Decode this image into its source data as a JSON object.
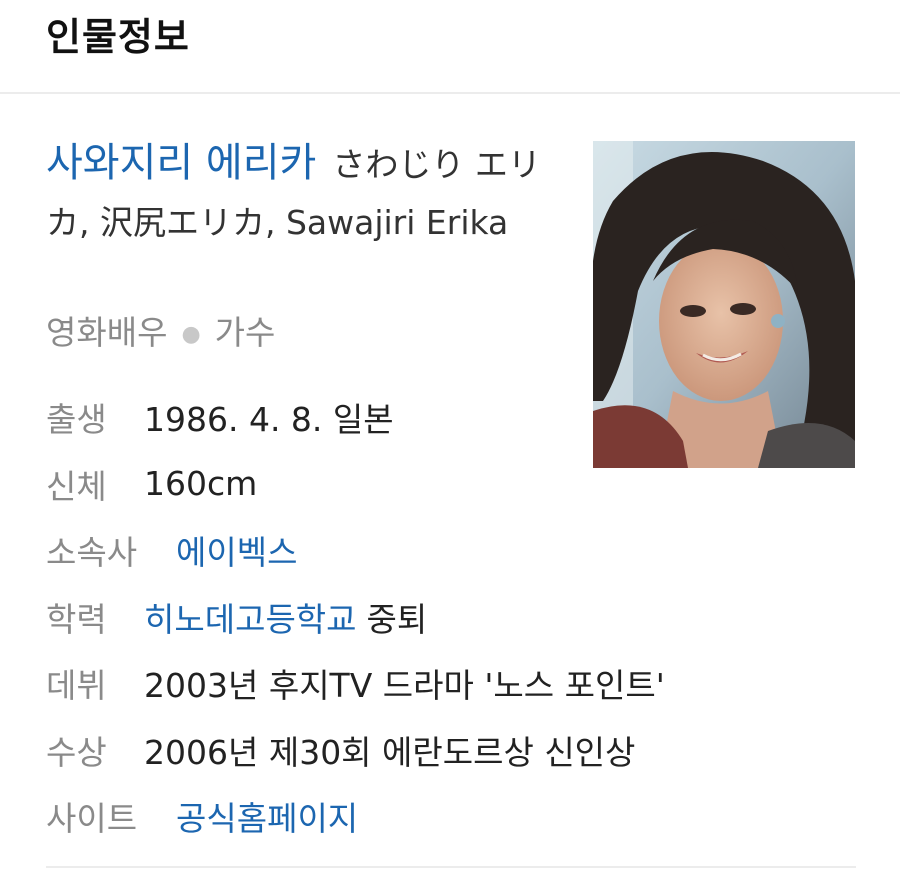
{
  "header": {
    "title": "인물정보"
  },
  "profile": {
    "name_ko": "사와지리 에리카",
    "name_jp": "さわじり エリカ, 沢尻エリカ, Sawajiri Erika",
    "occupations": [
      "영화배우",
      "가수"
    ],
    "photo_icon": "portrait-photo"
  },
  "info": {
    "birth": {
      "label": "출생",
      "value": "1986. 4. 8. 일본"
    },
    "body": {
      "label": "신체",
      "value": "160cm"
    },
    "agency": {
      "label": "소속사",
      "link": "에이벡스"
    },
    "education": {
      "label": "학력",
      "link": "히노데고등학교",
      "suffix": "중퇴"
    },
    "debut": {
      "label": "데뷔",
      "value": "2003년 후지TV 드라마 '노스 포인트'"
    },
    "award": {
      "label": "수상",
      "value": "2006년 제30회 에란도르상 신인상"
    },
    "site": {
      "label": "사이트",
      "link": "공식홈페이지"
    }
  },
  "colors": {
    "link": "#1c66b0",
    "label": "#8a8a8a",
    "text": "#222222",
    "divider": "#ececec"
  }
}
